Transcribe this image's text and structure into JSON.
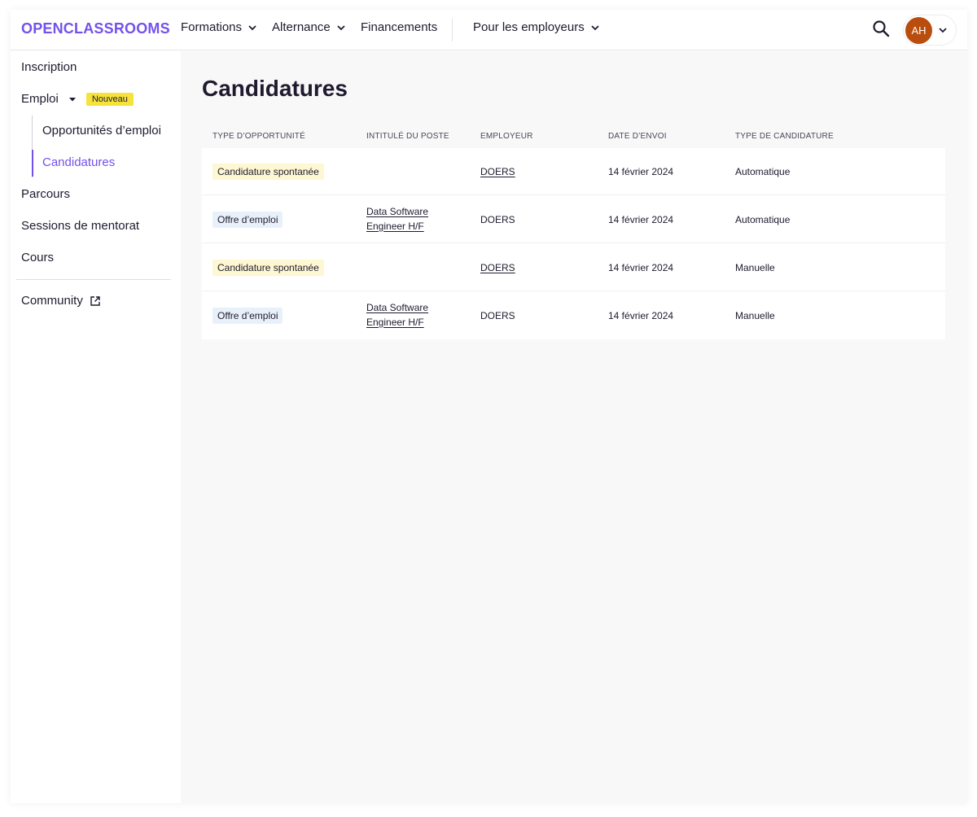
{
  "header": {
    "logo": "OPENCLASSROOMS",
    "nav": [
      {
        "label": "Formations",
        "has_dropdown": true
      },
      {
        "label": "Alternance",
        "has_dropdown": true
      },
      {
        "label": "Financements",
        "has_dropdown": false
      },
      {
        "label": "Pour les employeurs",
        "has_dropdown": true
      }
    ],
    "avatar_initials": "AH"
  },
  "sidebar": {
    "items": [
      {
        "label": "Inscription"
      },
      {
        "label": "Emploi",
        "badge": "Nouveau"
      },
      {
        "label": "Opportunités d’emploi"
      },
      {
        "label": "Candidatures",
        "active": true
      },
      {
        "label": "Parcours"
      },
      {
        "label": "Sessions de mentorat"
      },
      {
        "label": "Cours"
      },
      {
        "label": "Community",
        "external": true
      }
    ]
  },
  "main": {
    "title": "Candidatures",
    "columns": [
      "TYPE D’OPPORTUNITÉ",
      "INTITULÉ DU POSTE",
      "EMPLOYEUR",
      "DATE D’ENVOI",
      "TYPE DE CANDIDATURE"
    ],
    "rows": [
      {
        "type": "Candidature spontanée",
        "title": "",
        "employer": "DOERS",
        "date": "14 février 2024",
        "mode": "Automatique"
      },
      {
        "type": "Offre d’emploi",
        "title": "Data Software Engineer H/F",
        "employer": "DOERS",
        "date": "14 février 2024",
        "mode": "Automatique"
      },
      {
        "type": "Candidature spontanée",
        "title": "",
        "employer": "DOERS",
        "date": "14 février 2024",
        "mode": "Manuelle"
      },
      {
        "type": "Offre d’emploi",
        "title": "Data Software Engineer H/F",
        "employer": "DOERS",
        "date": "14 février 2024",
        "mode": "Manuelle"
      }
    ]
  },
  "colors": {
    "brand": "#7451eb",
    "badge_new": "#f5e23a",
    "tag_spontaneous": "#fdf7d2",
    "tag_offer": "#e8f1fa",
    "avatar": "#b84d0e"
  }
}
